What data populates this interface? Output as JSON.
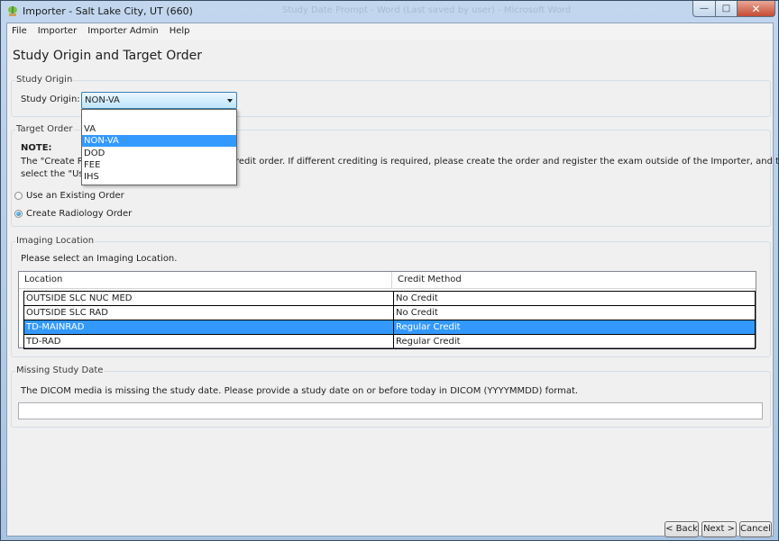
{
  "window": {
    "title": "Importer - Salt Lake City, UT (660)",
    "background_title": "Study Date Prompt - Word (Last saved by user) - Microsoft Word"
  },
  "menu": [
    "File",
    "Importer",
    "Importer Admin",
    "Help"
  ],
  "page_title": "Study Origin and Target Order",
  "study_origin": {
    "group_title": "Study Origin",
    "label": "Study Origin:",
    "selected": "NON-VA",
    "options": [
      "VA",
      "NON-VA",
      "DOD",
      "FEE",
      "IHS"
    ]
  },
  "target_order": {
    "group_title": "Target Order",
    "note_heading": "NOTE:",
    "note_line1_start": "The \"Create Ra",
    "note_line1_end": "redit order. If different crediting is required, please create the order and register the exam outside of the Importer, and then",
    "note_line2": "select the \"Use",
    "radio_existing": "Use an Existing Order",
    "radio_create": "Create Radiology Order",
    "selected_radio": "create"
  },
  "imaging_location": {
    "group_title": "Imaging Location",
    "prompt": "Please select an Imaging Location.",
    "columns": [
      "Location",
      "Credit Method"
    ],
    "rows": [
      {
        "location": "OUTSIDE SLC NUC MED",
        "credit": "No Credit"
      },
      {
        "location": "OUTSIDE SLC RAD",
        "credit": "No Credit"
      },
      {
        "location": "TD-MAINRAD",
        "credit": "Regular Credit"
      },
      {
        "location": "TD-RAD",
        "credit": "Regular Credit"
      }
    ],
    "selected_row": 2
  },
  "missing_date": {
    "group_title": "Missing Study Date",
    "message": "The DICOM media is missing the study date. Please provide a study date on or before today in DICOM (YYYYMMDD) format.",
    "value": ""
  },
  "buttons": {
    "back": "< Back",
    "next": "Next >",
    "cancel": "Cancel"
  },
  "colors": {
    "selection": "#3399ff",
    "frame": "#b9d1ea"
  }
}
